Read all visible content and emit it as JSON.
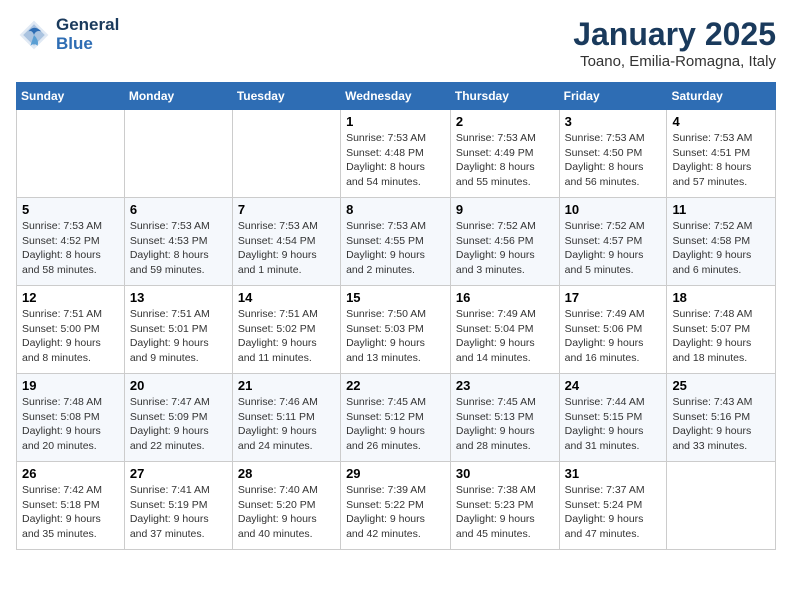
{
  "header": {
    "logo_line1": "General",
    "logo_line2": "Blue",
    "title": "January 2025",
    "subtitle": "Toano, Emilia-Romagna, Italy"
  },
  "weekdays": [
    "Sunday",
    "Monday",
    "Tuesday",
    "Wednesday",
    "Thursday",
    "Friday",
    "Saturday"
  ],
  "weeks": [
    [
      {
        "day": "",
        "info": ""
      },
      {
        "day": "",
        "info": ""
      },
      {
        "day": "",
        "info": ""
      },
      {
        "day": "1",
        "info": "Sunrise: 7:53 AM\nSunset: 4:48 PM\nDaylight: 8 hours\nand 54 minutes."
      },
      {
        "day": "2",
        "info": "Sunrise: 7:53 AM\nSunset: 4:49 PM\nDaylight: 8 hours\nand 55 minutes."
      },
      {
        "day": "3",
        "info": "Sunrise: 7:53 AM\nSunset: 4:50 PM\nDaylight: 8 hours\nand 56 minutes."
      },
      {
        "day": "4",
        "info": "Sunrise: 7:53 AM\nSunset: 4:51 PM\nDaylight: 8 hours\nand 57 minutes."
      }
    ],
    [
      {
        "day": "5",
        "info": "Sunrise: 7:53 AM\nSunset: 4:52 PM\nDaylight: 8 hours\nand 58 minutes."
      },
      {
        "day": "6",
        "info": "Sunrise: 7:53 AM\nSunset: 4:53 PM\nDaylight: 8 hours\nand 59 minutes."
      },
      {
        "day": "7",
        "info": "Sunrise: 7:53 AM\nSunset: 4:54 PM\nDaylight: 9 hours\nand 1 minute."
      },
      {
        "day": "8",
        "info": "Sunrise: 7:53 AM\nSunset: 4:55 PM\nDaylight: 9 hours\nand 2 minutes."
      },
      {
        "day": "9",
        "info": "Sunrise: 7:52 AM\nSunset: 4:56 PM\nDaylight: 9 hours\nand 3 minutes."
      },
      {
        "day": "10",
        "info": "Sunrise: 7:52 AM\nSunset: 4:57 PM\nDaylight: 9 hours\nand 5 minutes."
      },
      {
        "day": "11",
        "info": "Sunrise: 7:52 AM\nSunset: 4:58 PM\nDaylight: 9 hours\nand 6 minutes."
      }
    ],
    [
      {
        "day": "12",
        "info": "Sunrise: 7:51 AM\nSunset: 5:00 PM\nDaylight: 9 hours\nand 8 minutes."
      },
      {
        "day": "13",
        "info": "Sunrise: 7:51 AM\nSunset: 5:01 PM\nDaylight: 9 hours\nand 9 minutes."
      },
      {
        "day": "14",
        "info": "Sunrise: 7:51 AM\nSunset: 5:02 PM\nDaylight: 9 hours\nand 11 minutes."
      },
      {
        "day": "15",
        "info": "Sunrise: 7:50 AM\nSunset: 5:03 PM\nDaylight: 9 hours\nand 13 minutes."
      },
      {
        "day": "16",
        "info": "Sunrise: 7:49 AM\nSunset: 5:04 PM\nDaylight: 9 hours\nand 14 minutes."
      },
      {
        "day": "17",
        "info": "Sunrise: 7:49 AM\nSunset: 5:06 PM\nDaylight: 9 hours\nand 16 minutes."
      },
      {
        "day": "18",
        "info": "Sunrise: 7:48 AM\nSunset: 5:07 PM\nDaylight: 9 hours\nand 18 minutes."
      }
    ],
    [
      {
        "day": "19",
        "info": "Sunrise: 7:48 AM\nSunset: 5:08 PM\nDaylight: 9 hours\nand 20 minutes."
      },
      {
        "day": "20",
        "info": "Sunrise: 7:47 AM\nSunset: 5:09 PM\nDaylight: 9 hours\nand 22 minutes."
      },
      {
        "day": "21",
        "info": "Sunrise: 7:46 AM\nSunset: 5:11 PM\nDaylight: 9 hours\nand 24 minutes."
      },
      {
        "day": "22",
        "info": "Sunrise: 7:45 AM\nSunset: 5:12 PM\nDaylight: 9 hours\nand 26 minutes."
      },
      {
        "day": "23",
        "info": "Sunrise: 7:45 AM\nSunset: 5:13 PM\nDaylight: 9 hours\nand 28 minutes."
      },
      {
        "day": "24",
        "info": "Sunrise: 7:44 AM\nSunset: 5:15 PM\nDaylight: 9 hours\nand 31 minutes."
      },
      {
        "day": "25",
        "info": "Sunrise: 7:43 AM\nSunset: 5:16 PM\nDaylight: 9 hours\nand 33 minutes."
      }
    ],
    [
      {
        "day": "26",
        "info": "Sunrise: 7:42 AM\nSunset: 5:18 PM\nDaylight: 9 hours\nand 35 minutes."
      },
      {
        "day": "27",
        "info": "Sunrise: 7:41 AM\nSunset: 5:19 PM\nDaylight: 9 hours\nand 37 minutes."
      },
      {
        "day": "28",
        "info": "Sunrise: 7:40 AM\nSunset: 5:20 PM\nDaylight: 9 hours\nand 40 minutes."
      },
      {
        "day": "29",
        "info": "Sunrise: 7:39 AM\nSunset: 5:22 PM\nDaylight: 9 hours\nand 42 minutes."
      },
      {
        "day": "30",
        "info": "Sunrise: 7:38 AM\nSunset: 5:23 PM\nDaylight: 9 hours\nand 45 minutes."
      },
      {
        "day": "31",
        "info": "Sunrise: 7:37 AM\nSunset: 5:24 PM\nDaylight: 9 hours\nand 47 minutes."
      },
      {
        "day": "",
        "info": ""
      }
    ]
  ]
}
